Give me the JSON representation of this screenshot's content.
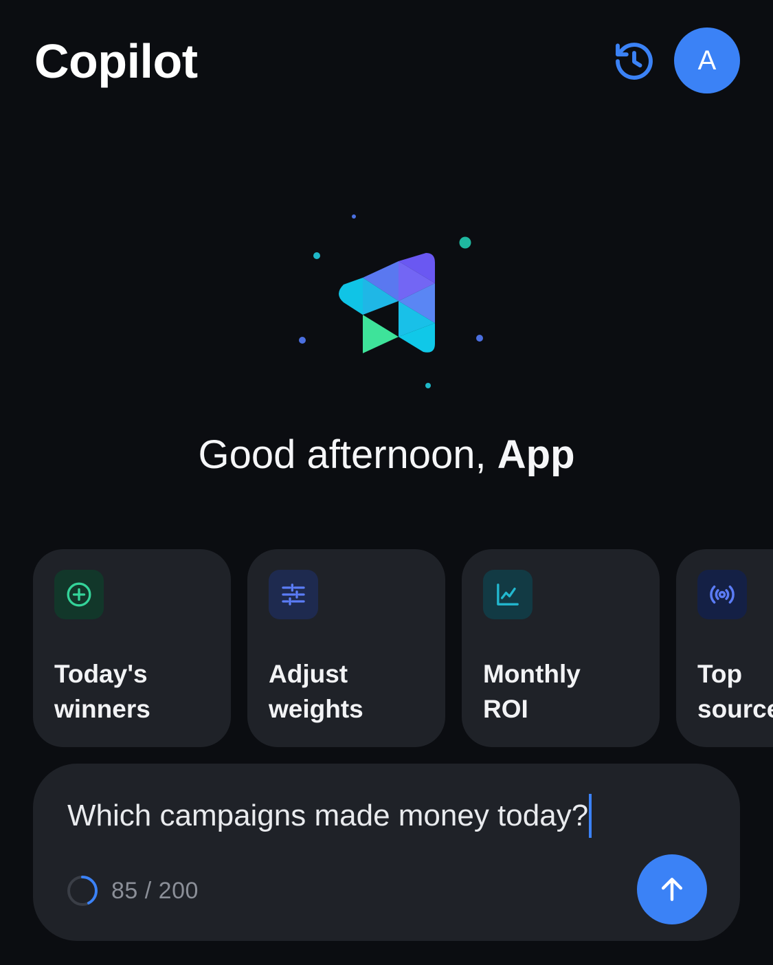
{
  "header": {
    "title": "Copilot",
    "history_icon": "history-icon",
    "avatar_initial": "A"
  },
  "greeting": {
    "prefix": "Good afternoon, ",
    "name": "App"
  },
  "suggestions": [
    {
      "label": "Today's\nwinners",
      "icon": "plus-circle-icon",
      "icon_color": "#34d399",
      "icon_bg": "#12372a"
    },
    {
      "label": "Adjust\nweights",
      "icon": "sliders-icon",
      "icon_color": "#5b7cf6",
      "icon_bg": "#1e2a4f"
    },
    {
      "label": "Monthly\nROI",
      "icon": "line-chart-icon",
      "icon_color": "#22b8cf",
      "icon_bg": "#123a44"
    },
    {
      "label": "Top\nsources",
      "icon": "broadcast-icon",
      "icon_color": "#5b7cf6",
      "icon_bg": "#142045"
    }
  ],
  "composer": {
    "value": "Which campaigns made money today?",
    "char_count": 85,
    "char_limit": 200,
    "counter_text": "85 / 200",
    "send_icon": "arrow-up-icon"
  },
  "colors": {
    "background": "#0b0d11",
    "card": "#1f2228",
    "accent": "#3b82f6"
  }
}
